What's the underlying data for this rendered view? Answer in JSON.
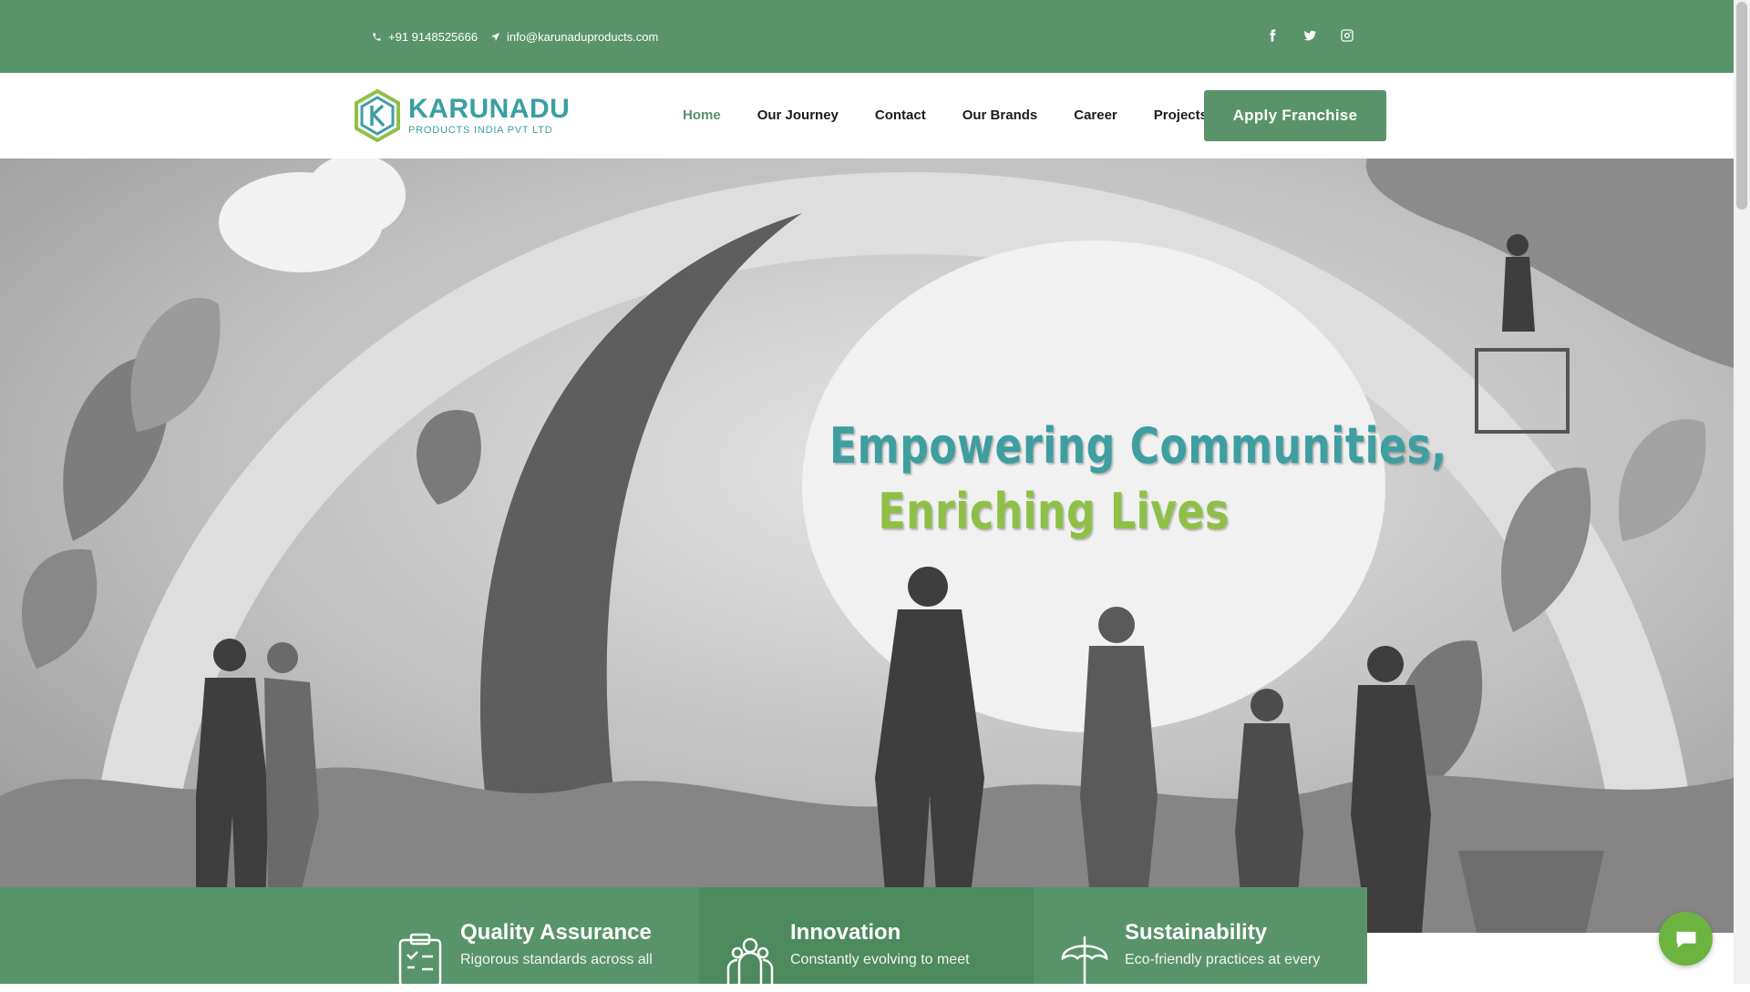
{
  "topbar": {
    "phone": "+91 9148525666",
    "email": "info@karunaduproducts.com",
    "social": [
      "facebook-icon",
      "twitter-icon",
      "instagram-icon"
    ]
  },
  "logo": {
    "brand": "KARUNADU",
    "subtitle": "PRODUCTS INDIA PVT LTD"
  },
  "nav": {
    "items": [
      "Home",
      "Our Journey",
      "Contact",
      "Our Brands",
      "Career",
      "Projects"
    ],
    "active": "Home",
    "cta": "Apply Franchise"
  },
  "hero": {
    "line1": "Empowering Communities,",
    "line2": "Enriching Lives"
  },
  "features": [
    {
      "title": "Quality Assurance",
      "desc": "Rigorous standards across all",
      "icon": "checklist-icon"
    },
    {
      "title": "Innovation",
      "desc": "Constantly evolving to meet",
      "icon": "team-icon"
    },
    {
      "title": "Sustainability",
      "desc": "Eco-friendly practices at every",
      "icon": "umbrella-icon"
    }
  ],
  "colors": {
    "brand_green": "#59936a",
    "teal": "#3e9ea0",
    "lime": "#8ec047",
    "chat_green": "#6cb33f"
  }
}
